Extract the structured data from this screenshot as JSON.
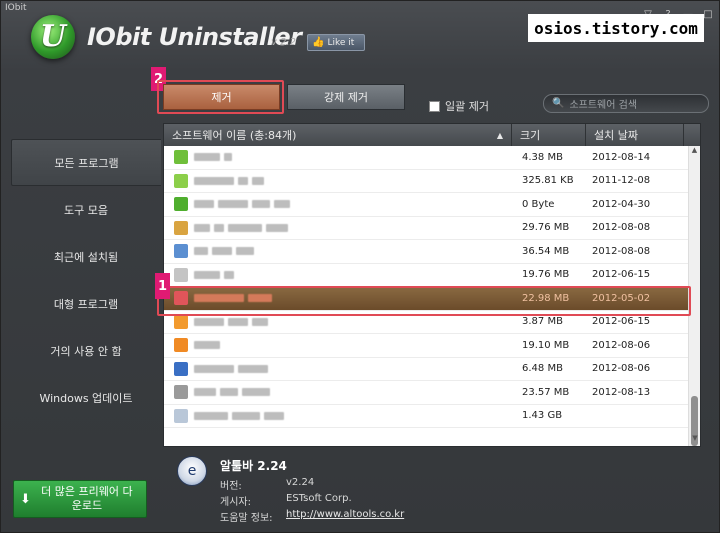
{
  "window": {
    "tiny_title": "IObit",
    "app_title": "IObit Uninstaller",
    "version": "v 2.2",
    "like_label": "Like it",
    "watermark": "osios.tistory.com",
    "controls": [
      "▽",
      "?",
      "—",
      "□",
      "✕"
    ]
  },
  "steps": {
    "one": "1",
    "two": "2"
  },
  "toolbar": {
    "remove_label": "제거",
    "force_remove_label": "강제 제거",
    "batch_label": "일괄 제거",
    "search_placeholder": "소프트웨어 검색"
  },
  "sidebar": {
    "items": [
      {
        "label": "모든 프로그램",
        "active": true
      },
      {
        "label": "도구 모음",
        "active": false
      },
      {
        "label": "최근에 설치됨",
        "active": false
      },
      {
        "label": "대형 프로그램",
        "active": false
      },
      {
        "label": "거의 사용 안 함",
        "active": false
      },
      {
        "label": "Windows 업데이트",
        "active": false
      }
    ],
    "more_label": "더 많은 프리웨어 다운로드"
  },
  "table": {
    "headers": {
      "name": "소프트웨어 이름 (총:84개)",
      "size": "크기",
      "date": "설치 날짜",
      "sort_icon": "▲"
    },
    "rows": [
      {
        "size": "4.38 MB",
        "date": "2012-08-14",
        "icon_color": "#6fbf3a"
      },
      {
        "size": "325.81 KB",
        "date": "2011-12-08",
        "icon_color": "#8ccf4a"
      },
      {
        "size": "0 Byte",
        "date": "2012-04-30",
        "icon_color": "#4fae2e"
      },
      {
        "size": "29.76 MB",
        "date": "2012-08-08",
        "icon_color": "#d9a441"
      },
      {
        "size": "36.54 MB",
        "date": "2012-08-08",
        "icon_color": "#5b8fd1"
      },
      {
        "size": "19.76 MB",
        "date": "2012-06-15",
        "icon_color": "#c4c4c4"
      },
      {
        "size": "22.98 MB",
        "date": "2012-05-02",
        "icon_color": "#e0555a",
        "selected": true
      },
      {
        "size": "3.87 MB",
        "date": "2012-06-15",
        "icon_color": "#f29a2e"
      },
      {
        "size": "19.10 MB",
        "date": "2012-08-06",
        "icon_color": "#f08a24"
      },
      {
        "size": "6.48 MB",
        "date": "2012-08-06",
        "icon_color": "#3a6fc4"
      },
      {
        "size": "23.57 MB",
        "date": "2012-08-13",
        "icon_color": "#9a9a9a"
      },
      {
        "size": "1.43 GB",
        "date": "",
        "icon_color": "#b9c7d8"
      }
    ]
  },
  "detail": {
    "title": "알툴바 2.24",
    "version_label": "버전:",
    "version_value": "v2.24",
    "publisher_label": "게시자:",
    "publisher_value": "ESTsoft Corp.",
    "help_label": "도움말 정보:",
    "help_value": "http://www.altools.co.kr"
  }
}
